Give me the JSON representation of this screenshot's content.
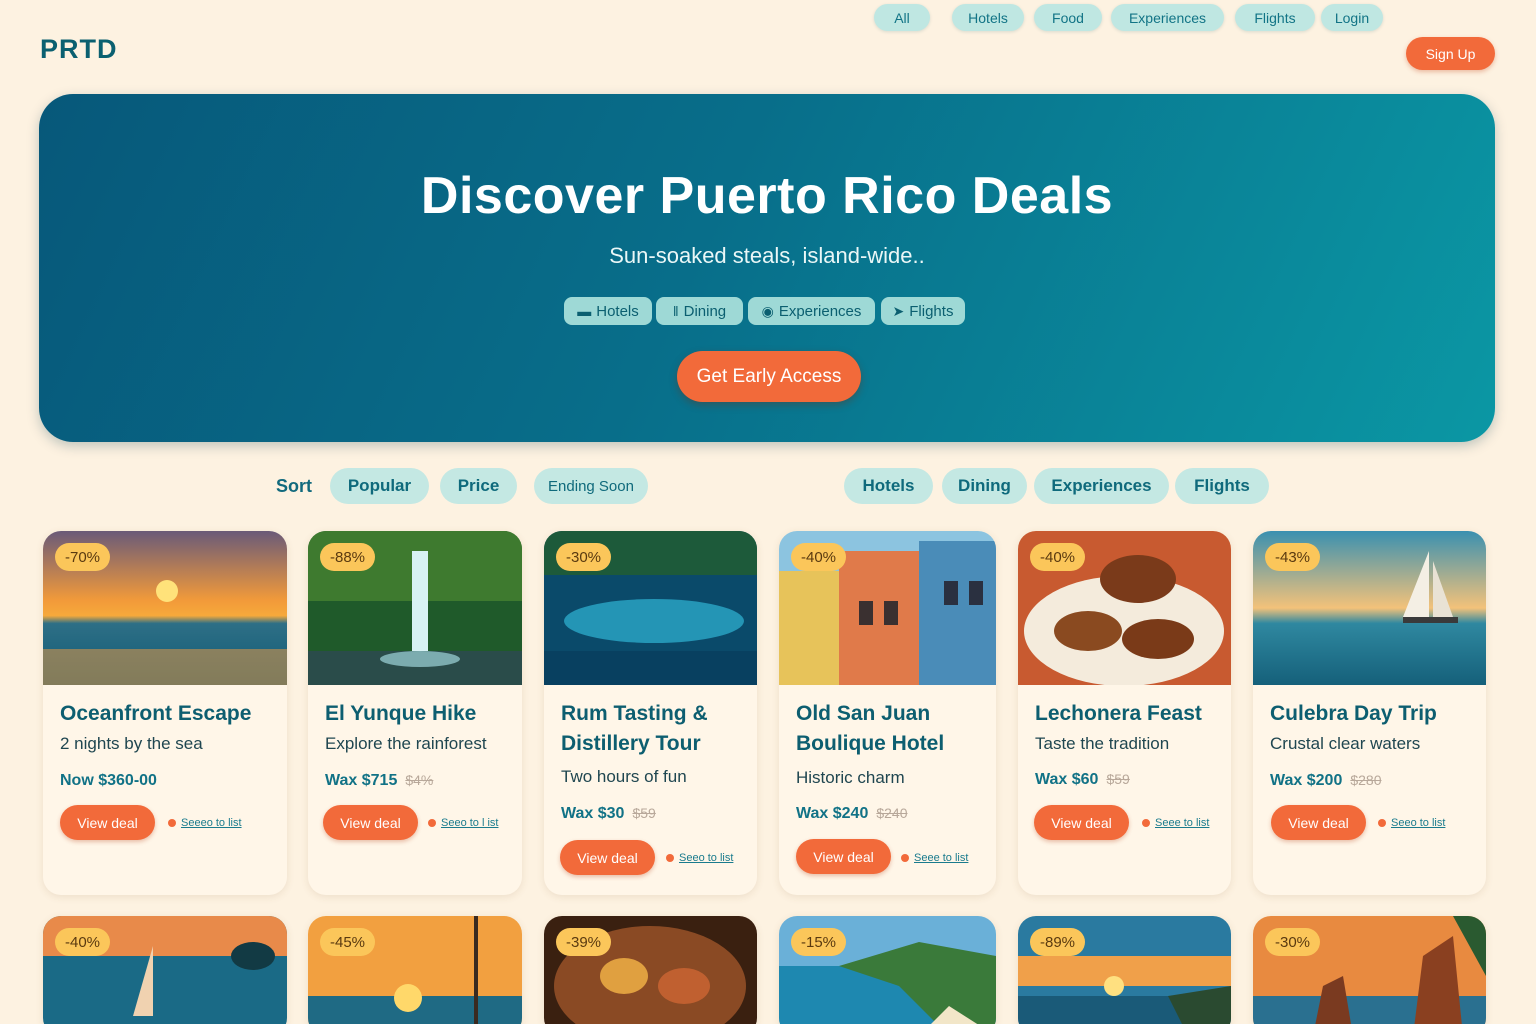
{
  "brand": "PRTD",
  "nav": {
    "items": [
      "All",
      "Hotels",
      "Food",
      "Experiences",
      "Flights",
      "Login"
    ],
    "signup": "Sign Up"
  },
  "hero": {
    "title": "Discover Puerto Rico Deals",
    "subtitle": "Sun-soaked steals, island-wide..",
    "chips": [
      {
        "label": "Hotels",
        "icon": "bed-icon"
      },
      {
        "label": "Dining",
        "icon": "cutlery-icon"
      },
      {
        "label": "Experiences",
        "icon": "globe-icon"
      },
      {
        "label": "Flights",
        "icon": "plane-icon"
      }
    ],
    "cta": "Get Early Access"
  },
  "filters": {
    "sort_label": "Sort",
    "sort": [
      "Popular",
      "Price",
      "Ending Soon"
    ],
    "categories": [
      "Hotels",
      "Dining",
      "Experiences",
      "Flights"
    ]
  },
  "cards": [
    {
      "badge": "-70%",
      "title": "Oceanfront Escape",
      "desc": "2 nights by the sea",
      "price": "Now $360-00",
      "old": "",
      "view": "View deal",
      "save": "Seeeo to list",
      "scene": "sunset-sea"
    },
    {
      "badge": "-88%",
      "title": "El Yunque Hike",
      "desc": "Explore the rainforest",
      "price": "Wax $715",
      "old": "$4%",
      "view": "View deal",
      "save": "Seeo to l ist",
      "scene": "waterfall"
    },
    {
      "badge": "-30%",
      "title": "Rum Tasting & Distillery Tour",
      "desc": "Two hours of fun",
      "price": "Wax $30",
      "old": "$59",
      "view": "View deal",
      "save": "Seeo to list",
      "scene": "ocean-wave"
    },
    {
      "badge": "-40%",
      "title": "Old San Juan Boulique Hotel",
      "desc": "Historic charm",
      "price": "Wax $240",
      "old": "$240",
      "view": "View deal",
      "save": "Seee to list",
      "scene": "colonial-street"
    },
    {
      "badge": "-40%",
      "title": "Lechonera Feast",
      "desc": "Taste the tradition",
      "price": "Wax $60",
      "old": "$59",
      "view": "View deal",
      "save": "Seee to list",
      "scene": "food-plate"
    },
    {
      "badge": "-43%",
      "title": "Culebra Day Trip",
      "desc": "Crustal clear waters",
      "price": "Wax $200",
      "old": "$280",
      "view": "View deal",
      "save": "Seeo to list",
      "scene": "sailboat"
    }
  ],
  "row2": [
    {
      "badge": "-40%",
      "scene": "sunset-sailboat"
    },
    {
      "badge": "-45%",
      "scene": "sunset-mast"
    },
    {
      "badge": "-39%",
      "scene": "food-bowl"
    },
    {
      "badge": "-15%",
      "scene": "coast-beach"
    },
    {
      "badge": "-89%",
      "scene": "sunset-shore"
    },
    {
      "badge": "-30%",
      "scene": "sea-rocks"
    }
  ],
  "colors": {
    "background": "#fdf2e1",
    "accent": "#f26a3a",
    "teal": "#0b6070",
    "pill": "#c4e8e3",
    "badge": "#fbc65a"
  }
}
